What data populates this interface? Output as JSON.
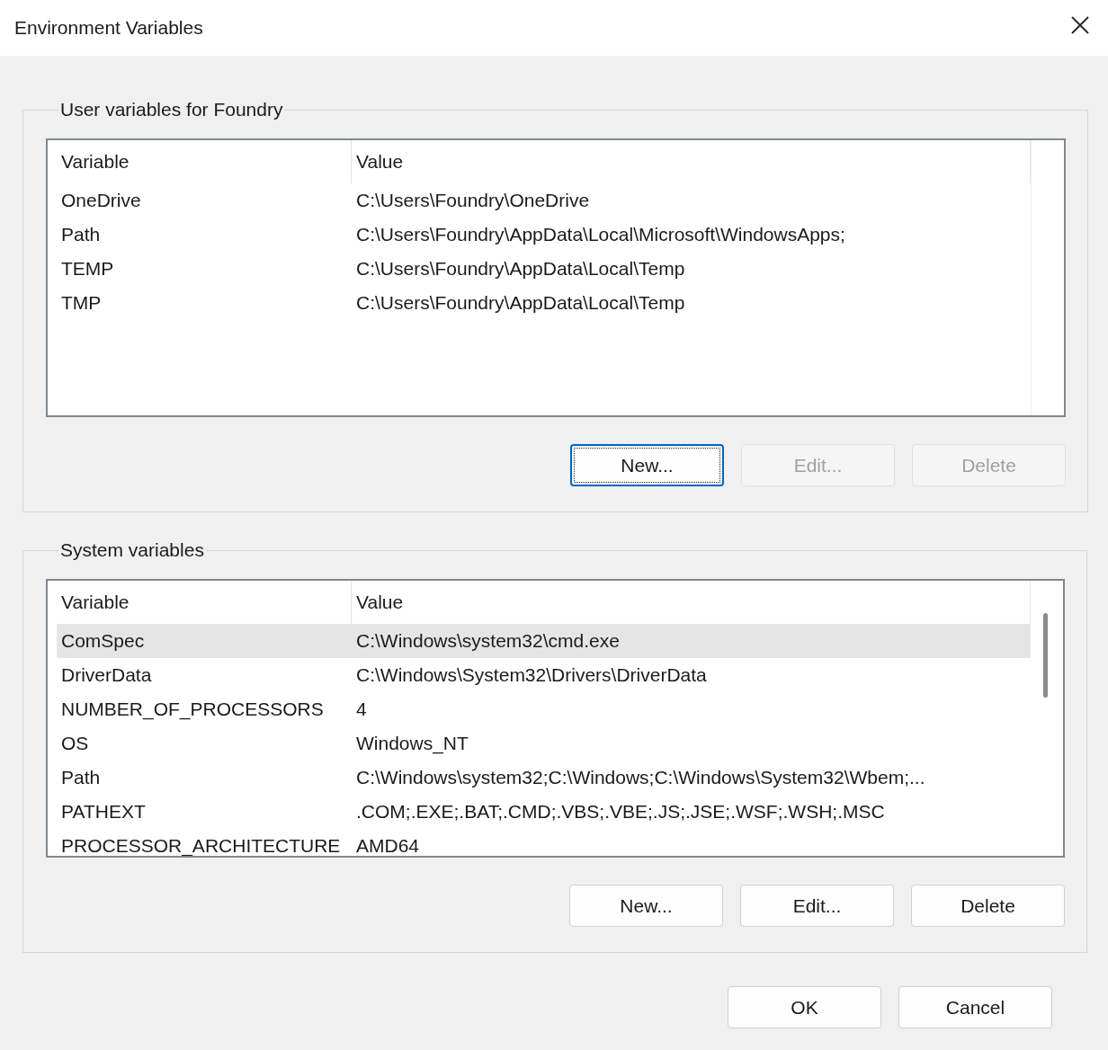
{
  "window": {
    "title": "Environment Variables"
  },
  "groups": [
    {
      "label": "User variables for Foundry",
      "columns": [
        "Variable",
        "Value"
      ],
      "scrollbar": false,
      "rows": [
        {
          "variable": "OneDrive",
          "value": "C:\\Users\\Foundry\\OneDrive",
          "selected": false
        },
        {
          "variable": "Path",
          "value": "C:\\Users\\Foundry\\AppData\\Local\\Microsoft\\WindowsApps;",
          "selected": false
        },
        {
          "variable": "TEMP",
          "value": "C:\\Users\\Foundry\\AppData\\Local\\Temp",
          "selected": false
        },
        {
          "variable": "TMP",
          "value": "C:\\Users\\Foundry\\AppData\\Local\\Temp",
          "selected": false
        }
      ],
      "buttons": [
        {
          "label": "New...",
          "disabled": false,
          "focused": true
        },
        {
          "label": "Edit...",
          "disabled": true,
          "focused": false
        },
        {
          "label": "Delete",
          "disabled": true,
          "focused": false
        }
      ]
    },
    {
      "label": "System variables",
      "columns": [
        "Variable",
        "Value"
      ],
      "scrollbar": true,
      "rows": [
        {
          "variable": "ComSpec",
          "value": "C:\\Windows\\system32\\cmd.exe",
          "selected": true
        },
        {
          "variable": "DriverData",
          "value": "C:\\Windows\\System32\\Drivers\\DriverData",
          "selected": false
        },
        {
          "variable": "NUMBER_OF_PROCESSORS",
          "value": "4",
          "selected": false
        },
        {
          "variable": "OS",
          "value": "Windows_NT",
          "selected": false
        },
        {
          "variable": "Path",
          "value": "C:\\Windows\\system32;C:\\Windows;C:\\Windows\\System32\\Wbem;...",
          "selected": false
        },
        {
          "variable": "PATHEXT",
          "value": ".COM;.EXE;.BAT;.CMD;.VBS;.VBE;.JS;.JSE;.WSF;.WSH;.MSC",
          "selected": false
        },
        {
          "variable": "PROCESSOR_ARCHITECTURE",
          "value": "AMD64",
          "selected": false
        }
      ],
      "buttons": [
        {
          "label": "New...",
          "disabled": false,
          "focused": false
        },
        {
          "label": "Edit...",
          "disabled": false,
          "focused": false
        },
        {
          "label": "Delete",
          "disabled": false,
          "focused": false
        }
      ]
    }
  ],
  "footer_buttons": [
    {
      "label": "OK",
      "disabled": false,
      "focused": false
    },
    {
      "label": "Cancel",
      "disabled": false,
      "focused": false
    }
  ]
}
